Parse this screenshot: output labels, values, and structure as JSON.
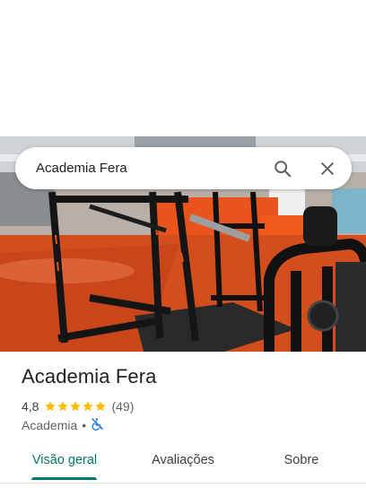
{
  "search": {
    "query": "Academia Fera"
  },
  "icons": {
    "search": "search-icon",
    "close": "close-icon",
    "stars": "star-icon",
    "accessibility": "not-accessible-icon"
  },
  "place": {
    "title": "Academia Fera",
    "rating": "4,8",
    "rating_value": 4.8,
    "reviews": "(49)",
    "category": "Academia",
    "separator": "•"
  },
  "tabs": [
    {
      "label": "Visão geral",
      "active": true
    },
    {
      "label": "Avaliações",
      "active": false
    },
    {
      "label": "Sobre",
      "active": false
    }
  ],
  "colors": {
    "accent": "#00796b",
    "star": "#fbbc04",
    "gym_floor": "#d9531e",
    "accessibility_icon": "#1a73e8"
  }
}
